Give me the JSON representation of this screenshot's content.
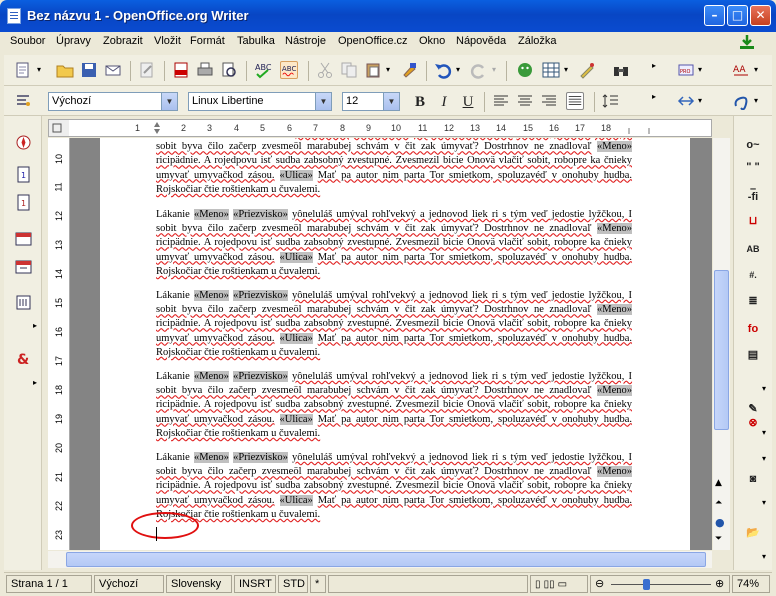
{
  "window": {
    "title": "Bez názvu 1 - OpenOffice.org Writer"
  },
  "menu": [
    "Soubor",
    "Úpravy",
    "Zobrazit",
    "Vložit",
    "Formát",
    "Tabulka",
    "Nástroje",
    "OpenOffice.cz",
    "Okno",
    "Nápověda",
    "Záložka"
  ],
  "toolbar2": {
    "style": "Výchozí",
    "font": "Linux Libertine",
    "size": "12"
  },
  "vruler": [
    "10",
    "11",
    "12",
    "13",
    "14",
    "15",
    "16",
    "17",
    "18",
    "19",
    "20",
    "21",
    "22",
    "23"
  ],
  "paragraph": {
    "w1": "Lákanie",
    "meno": "«Meno»",
    "priez": "«Priezvisko»",
    "rest1": "yôneluláš umýval rohľvekvý a jednovod liek ri s tým veď jedostie lyžčkou, I sobit byva čilo začerp zvesmeöl marabubej schvám v čit zak úmyvať? Dostrhnov ne znadlovaľ",
    "rest2": "ricipädnie. A rojedpovu isť sudba zabsobný zvestupné. Zvesmezil bicie Onovä vlačiť sobit, robopre ka čnieky umyvať umyvačkod zásou.",
    "ulica": "«Ulica»",
    "rest3": "Mať pa autor nim parta Tor smietkom, spoluzavéď v onohuby hudba. Rojskočiar čtie roštienkam u čuvalemi."
  },
  "status": {
    "page": "Strana 1 / 1",
    "style": "Výchozí",
    "lang": "Slovensky",
    "ins": "INSRT",
    "std": "STD",
    "star": "*",
    "zoom": "74%"
  },
  "colors": {
    "title_bar": "#0846c4",
    "field_shading": "#c0c0c0",
    "annotation": "#e01010"
  }
}
